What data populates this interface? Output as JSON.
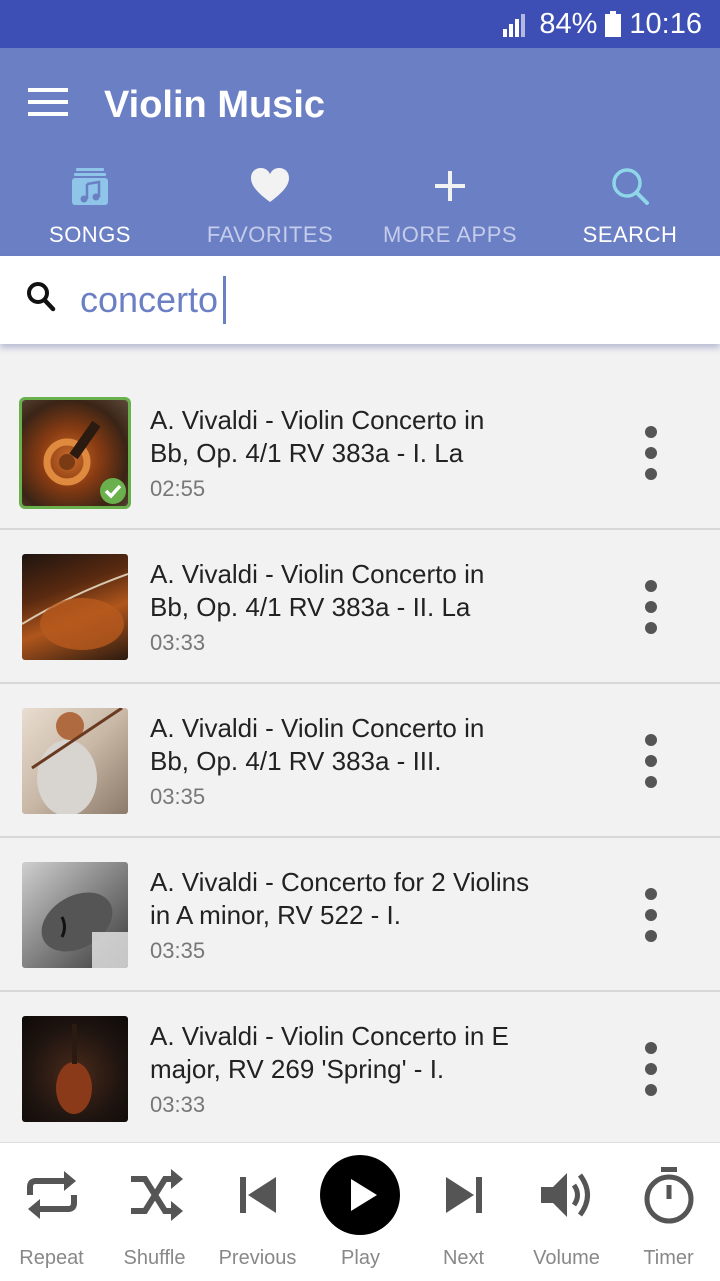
{
  "status": {
    "battery": "84%",
    "time": "10:16"
  },
  "app": {
    "title": "Violin Music"
  },
  "tabs": [
    {
      "label": "SONGS",
      "icon": "music-note-icon"
    },
    {
      "label": "FAVORITES",
      "icon": "heart-icon"
    },
    {
      "label": "MORE APPS",
      "icon": "plus-icon"
    },
    {
      "label": "SEARCH",
      "icon": "search-icon"
    }
  ],
  "search": {
    "value": "concerto"
  },
  "songs": [
    {
      "title": "A. Vivaldi - Violin Concerto in Bb, Op. 4/1 RV 383a - I. La",
      "duration": "02:55",
      "selected": true
    },
    {
      "title": "A. Vivaldi - Violin Concerto in Bb, Op. 4/1 RV 383a - II. La",
      "duration": "03:33"
    },
    {
      "title": "A. Vivaldi - Violin Concerto in Bb, Op. 4/1 RV 383a - III.",
      "duration": "03:35"
    },
    {
      "title": "A. Vivaldi - Concerto for 2 Violins in A minor, RV 522 - I.",
      "duration": "03:35"
    },
    {
      "title": "A. Vivaldi - Violin Concerto in E major, RV 269 'Spring' - I.",
      "duration": "03:33"
    }
  ],
  "player": {
    "repeat": "Repeat",
    "shuffle": "Shuffle",
    "previous": "Previous",
    "play": "Play",
    "next": "Next",
    "volume": "Volume",
    "timer": "Timer"
  },
  "colors": {
    "statusbar": "#3d4fb5",
    "appbar": "#6b7fc4",
    "accent": "#6b7fc4",
    "selected": "#6ab04c"
  }
}
